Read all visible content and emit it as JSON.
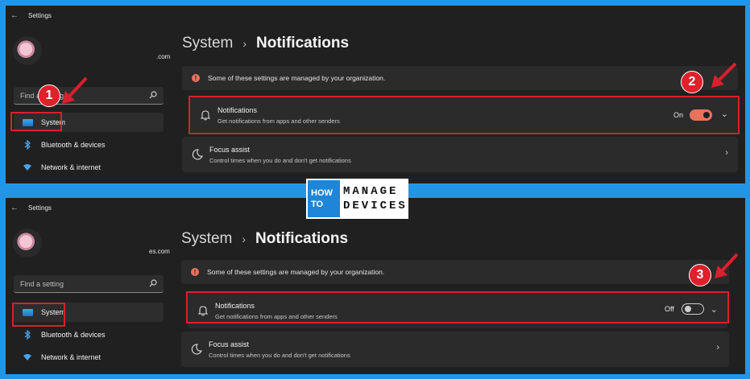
{
  "logo": {
    "line1": "HOW",
    "line2": "TO",
    "line3": "MANAGE",
    "line4": "DEVICES"
  },
  "colors": {
    "frame": "#2196e6",
    "window_bg": "#202020",
    "card_bg": "#2b2b2b",
    "accent": "#e8735c",
    "highlight": "#d9202c"
  },
  "top": {
    "app_title": "Settings",
    "account_email": ".com",
    "search_placeholder": "Find a setting",
    "nav": [
      {
        "label": "System",
        "icon": "system-icon"
      },
      {
        "label": "Bluetooth & devices",
        "icon": "bluetooth-icon"
      },
      {
        "label": "Network & internet",
        "icon": "wifi-icon"
      }
    ],
    "breadcrumb_parent": "System",
    "breadcrumb_current": "Notifications",
    "managed_notice": "Some of these settings are managed by your organization.",
    "notifications": {
      "title": "Notifications",
      "desc": "Get notifications from apps and other senders",
      "state": "On"
    },
    "focus": {
      "title": "Focus assist",
      "desc": "Control times when you do and don't get notifications"
    },
    "badges": [
      "1",
      "2"
    ]
  },
  "bottom": {
    "app_title": "Settings",
    "account_email": "es.com",
    "search_placeholder": "Find a setting",
    "nav": [
      {
        "label": "System",
        "icon": "system-icon"
      },
      {
        "label": "Bluetooth & devices",
        "icon": "bluetooth-icon"
      },
      {
        "label": "Network & internet",
        "icon": "wifi-icon"
      }
    ],
    "breadcrumb_parent": "System",
    "breadcrumb_current": "Notifications",
    "managed_notice": "Some of these settings are managed by your organization.",
    "notifications": {
      "title": "Notifications",
      "desc": "Get notifications from apps and other senders",
      "state": "Off"
    },
    "focus": {
      "title": "Focus assist",
      "desc": "Control times when you do and don't get notifications"
    },
    "badges": [
      "3"
    ]
  }
}
